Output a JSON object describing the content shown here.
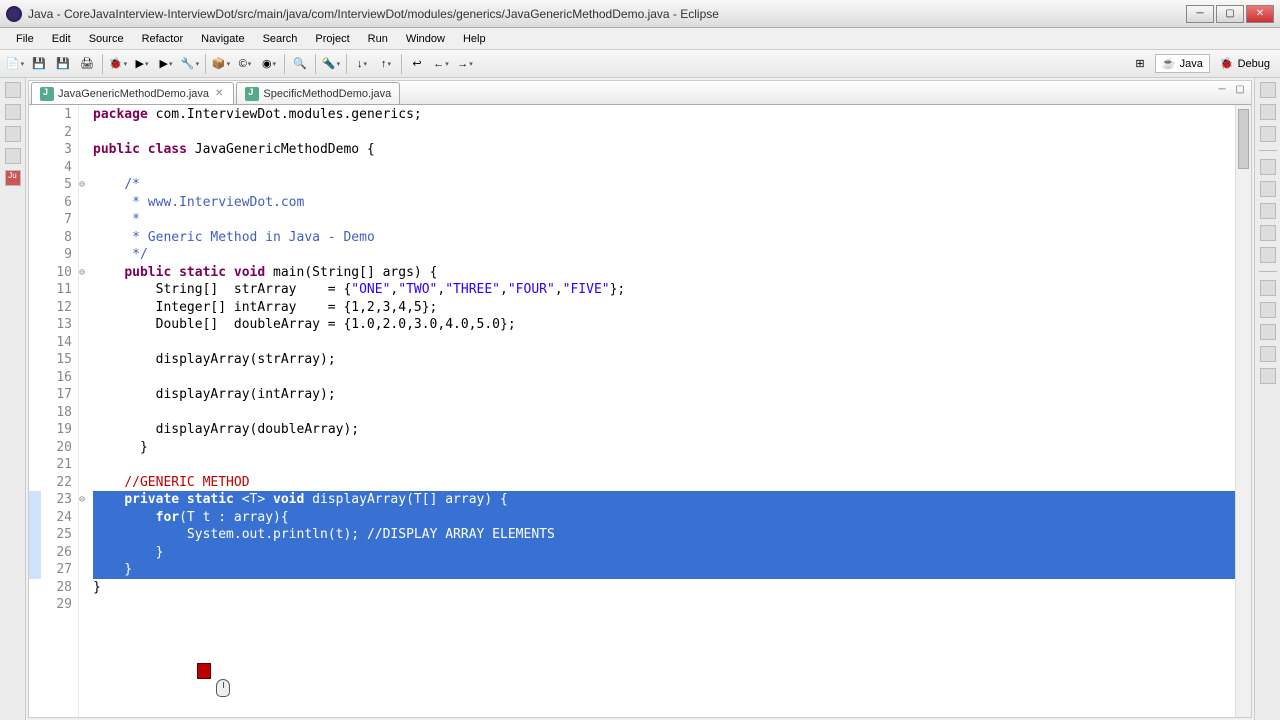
{
  "title": "Java - CoreJavaInterview-InterviewDot/src/main/java/com/InterviewDot/modules/generics/JavaGenericMethodDemo.java - Eclipse",
  "menu": [
    "File",
    "Edit",
    "Source",
    "Refactor",
    "Navigate",
    "Search",
    "Project",
    "Run",
    "Window",
    "Help"
  ],
  "tabs": [
    {
      "label": "JavaGenericMethodDemo.java",
      "active": true
    },
    {
      "label": "SpecificMethodDemo.java",
      "active": false
    }
  ],
  "perspectives": {
    "java": "Java",
    "debug": "Debug"
  },
  "code_lines": [
    {
      "n": 1,
      "fold": "",
      "tokens": [
        [
          "kw",
          "package"
        ],
        [
          "",
          " com.InterviewDot.modules.generics;"
        ]
      ]
    },
    {
      "n": 2,
      "fold": "",
      "tokens": [
        [
          "",
          ""
        ]
      ]
    },
    {
      "n": 3,
      "fold": "",
      "tokens": [
        [
          "kw",
          "public class"
        ],
        [
          "",
          " JavaGenericMethodDemo {"
        ]
      ]
    },
    {
      "n": 4,
      "fold": "",
      "tokens": [
        [
          "",
          ""
        ]
      ]
    },
    {
      "n": 5,
      "fold": "⊖",
      "tokens": [
        [
          "",
          "    "
        ],
        [
          "cm",
          "/*"
        ]
      ]
    },
    {
      "n": 6,
      "fold": "",
      "tokens": [
        [
          "",
          "    "
        ],
        [
          "cm",
          " * www.InterviewDot.com"
        ]
      ]
    },
    {
      "n": 7,
      "fold": "",
      "tokens": [
        [
          "",
          "    "
        ],
        [
          "cm",
          " *"
        ]
      ]
    },
    {
      "n": 8,
      "fold": "",
      "tokens": [
        [
          "",
          "    "
        ],
        [
          "cm",
          " * Generic Method in Java - Demo"
        ]
      ]
    },
    {
      "n": 9,
      "fold": "",
      "tokens": [
        [
          "",
          "    "
        ],
        [
          "cm",
          " */"
        ]
      ]
    },
    {
      "n": 10,
      "fold": "⊖",
      "tokens": [
        [
          "",
          "    "
        ],
        [
          "kw",
          "public static void"
        ],
        [
          "",
          " main(String[] args) {"
        ]
      ]
    },
    {
      "n": 11,
      "fold": "",
      "tokens": [
        [
          "",
          "        String[]  strArray    = {"
        ],
        [
          "str",
          "\"ONE\""
        ],
        [
          "",
          ","
        ],
        [
          "str",
          "\"TWO\""
        ],
        [
          "",
          ","
        ],
        [
          "str",
          "\"THREE\""
        ],
        [
          "",
          ","
        ],
        [
          "str",
          "\"FOUR\""
        ],
        [
          "",
          ","
        ],
        [
          "str",
          "\"FIVE\""
        ],
        [
          "",
          "};"
        ]
      ]
    },
    {
      "n": 12,
      "fold": "",
      "tokens": [
        [
          "",
          "        Integer[] intArray    = {1,2,3,4,5};"
        ]
      ]
    },
    {
      "n": 13,
      "fold": "",
      "tokens": [
        [
          "",
          "        Double[]  doubleArray = {1.0,2.0,3.0,4.0,5.0};"
        ]
      ]
    },
    {
      "n": 14,
      "fold": "",
      "tokens": [
        [
          "",
          ""
        ]
      ]
    },
    {
      "n": 15,
      "fold": "",
      "tokens": [
        [
          "",
          "        "
        ],
        [
          "",
          "displayArray"
        ],
        [
          "",
          "(strArray);"
        ]
      ]
    },
    {
      "n": 16,
      "fold": "",
      "tokens": [
        [
          "",
          ""
        ]
      ]
    },
    {
      "n": 17,
      "fold": "",
      "tokens": [
        [
          "",
          "        "
        ],
        [
          "",
          "displayArray"
        ],
        [
          "",
          "(intArray);"
        ]
      ]
    },
    {
      "n": 18,
      "fold": "",
      "tokens": [
        [
          "",
          ""
        ]
      ]
    },
    {
      "n": 19,
      "fold": "",
      "tokens": [
        [
          "",
          "        "
        ],
        [
          "",
          "displayArray"
        ],
        [
          "",
          "(doubleArray);"
        ]
      ]
    },
    {
      "n": 20,
      "fold": "",
      "tokens": [
        [
          "",
          "      }"
        ]
      ]
    },
    {
      "n": 21,
      "fold": "",
      "tokens": [
        [
          "",
          ""
        ]
      ]
    },
    {
      "n": 22,
      "fold": "",
      "tokens": [
        [
          "",
          "    "
        ],
        [
          "cmred",
          "//GENERIC METHOD"
        ]
      ]
    },
    {
      "n": 23,
      "fold": "⊖",
      "tokens": [
        [
          "",
          "    "
        ],
        [
          "kw",
          "private static"
        ],
        [
          "",
          " <T> "
        ],
        [
          "kw",
          "void"
        ],
        [
          "",
          " displayArray(T[] array) {"
        ]
      ],
      "sel": true
    },
    {
      "n": 24,
      "fold": "",
      "tokens": [
        [
          "",
          "        "
        ],
        [
          "kw",
          "for"
        ],
        [
          "",
          "(T t : array){"
        ]
      ],
      "sel": true
    },
    {
      "n": 25,
      "fold": "",
      "tokens": [
        [
          "",
          "            System."
        ],
        [
          "",
          "out"
        ],
        [
          "",
          ".println(t); "
        ],
        [
          "cmred",
          "//DISPLAY ARRAY ELEMENTS"
        ]
      ],
      "sel": true
    },
    {
      "n": 26,
      "fold": "",
      "tokens": [
        [
          "",
          "        }"
        ]
      ],
      "sel": true
    },
    {
      "n": 27,
      "fold": "",
      "tokens": [
        [
          "",
          "    }"
        ]
      ],
      "sel": true
    },
    {
      "n": 28,
      "fold": "",
      "tokens": [
        [
          "",
          "}"
        ]
      ]
    },
    {
      "n": 29,
      "fold": "",
      "tokens": [
        [
          "",
          ""
        ]
      ]
    }
  ]
}
